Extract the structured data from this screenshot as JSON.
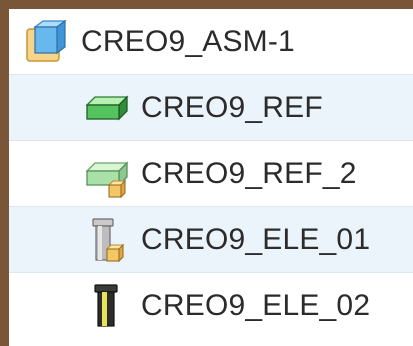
{
  "tree": {
    "root": {
      "label": "CREO9_ASM-1",
      "icon": "assembly-icon"
    },
    "children": [
      {
        "label": "CREO9_REF",
        "icon": "part-icon"
      },
      {
        "label": "CREO9_REF_2",
        "icon": "part-subassembly-icon"
      },
      {
        "label": "CREO9_ELE_01",
        "icon": "pin-subassembly-icon"
      },
      {
        "label": "CREO9_ELE_02",
        "icon": "pin-part-icon"
      }
    ]
  },
  "colors": {
    "frame": "#7a5638",
    "row_alt": "#ecf4fb",
    "part_green": "#4fc35a",
    "subassembly_yellow": "#f2c464",
    "assembly_blue": "#5fb0e6"
  }
}
